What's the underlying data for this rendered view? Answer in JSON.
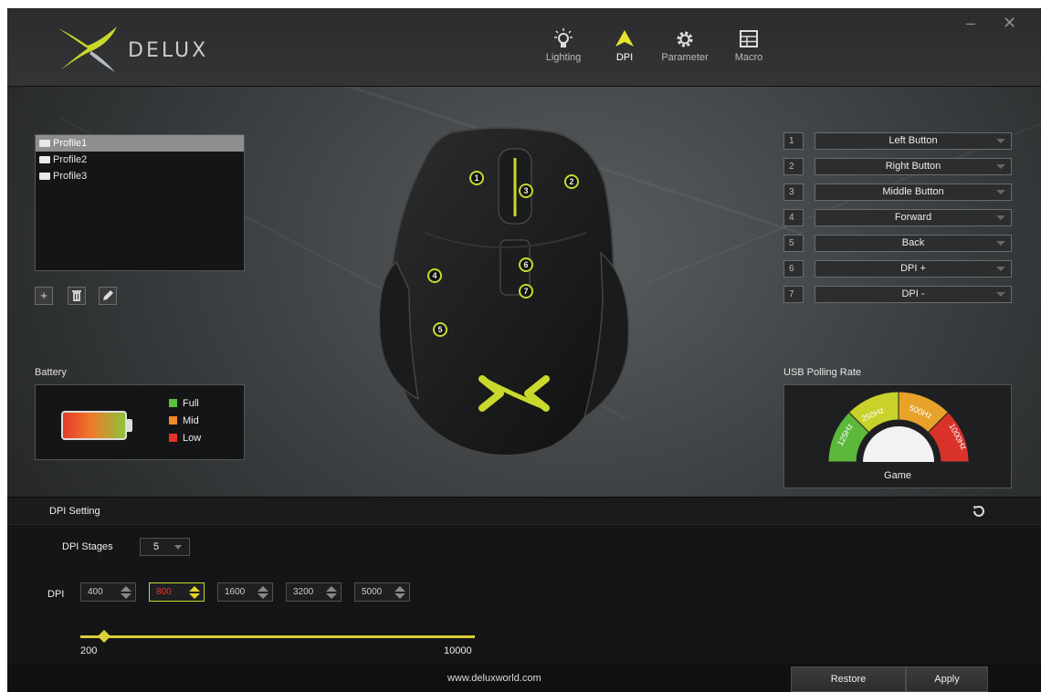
{
  "app": {
    "brand": "DELUX",
    "window_controls": {
      "minimize": "–",
      "close": "✕"
    }
  },
  "nav": {
    "tabs": [
      {
        "label": "Lighting",
        "icon": "lightbulb-icon"
      },
      {
        "label": "DPI",
        "icon": "arrow-up-icon"
      },
      {
        "label": "Parameter",
        "icon": "gear-icon"
      },
      {
        "label": "Macro",
        "icon": "grid-icon"
      }
    ],
    "active": "DPI"
  },
  "profiles": {
    "items": [
      "Profile1",
      "Profile2",
      "Profile3"
    ],
    "selected": "Profile1",
    "actions": {
      "add": "+",
      "delete": "trash-icon",
      "edit": "pencil-icon"
    }
  },
  "battery": {
    "title": "Battery",
    "legend": [
      {
        "label": "Full",
        "color": "#5cc23a"
      },
      {
        "label": "Mid",
        "color": "#f08a2a"
      },
      {
        "label": "Low",
        "color": "#e8322a"
      }
    ]
  },
  "mouse_buttons": {
    "markers": [
      "1",
      "2",
      "3",
      "4",
      "5",
      "6",
      "7"
    ],
    "mapping": [
      {
        "index": "1",
        "action": "Left Button"
      },
      {
        "index": "2",
        "action": "Right Button"
      },
      {
        "index": "3",
        "action": "Middle Button"
      },
      {
        "index": "4",
        "action": "Forward"
      },
      {
        "index": "5",
        "action": "Back"
      },
      {
        "index": "6",
        "action": "DPI +"
      },
      {
        "index": "7",
        "action": "DPI -"
      }
    ]
  },
  "polling": {
    "title": "USB Polling Rate",
    "rates": [
      "125Hz",
      "250Hz",
      "500Hz",
      "1000Hz"
    ],
    "colors": [
      "#5cb83a",
      "#c8d22a",
      "#e8a22a",
      "#d8322a"
    ],
    "mode": "Game"
  },
  "dpi": {
    "title": "DPI Setting",
    "stages_label": "DPI Stages",
    "stages_value": "5",
    "label": "DPI",
    "values": [
      "400",
      "800",
      "1600",
      "3200",
      "5000"
    ],
    "active_index": 1,
    "slider": {
      "min": "200",
      "max": "10000",
      "value": 800
    }
  },
  "footer": {
    "url": "www.deluxworld.com",
    "restore_label": "Restore",
    "apply_label": "Apply"
  },
  "colors": {
    "accent": "#c8d92b",
    "active_value": "#e33333"
  }
}
